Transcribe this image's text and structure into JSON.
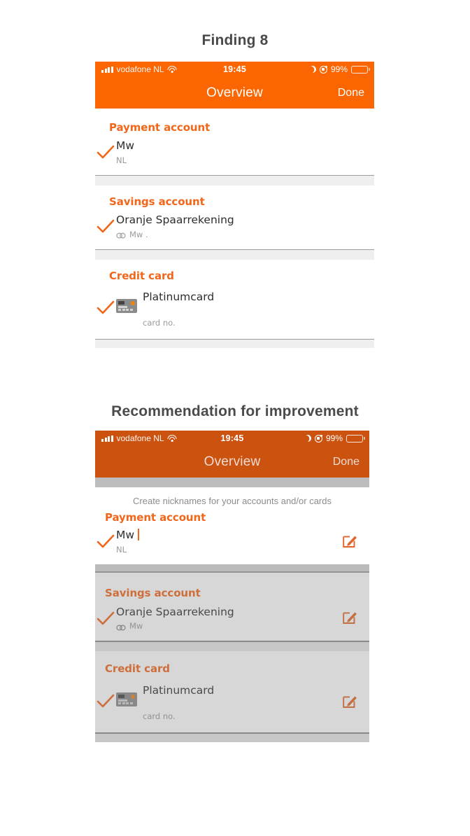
{
  "captions": {
    "finding": "Finding 8",
    "recommendation": "Recommendation for improvement"
  },
  "colors": {
    "accent_orange": "#f2661a",
    "header_orange": "#fb6502",
    "header_orange_dim": "#cc5210",
    "battery_yellow": "#f8cc0a",
    "divider_gray": "#9c9c9c",
    "band_gray": "#efefef",
    "subtext_gray": "#9a9a9a"
  },
  "status_bar": {
    "carrier": "vodafone NL",
    "time": "19:45",
    "battery_percent": "99%",
    "signal_icon": "signal-bars-icon",
    "wifi_icon": "wifi-icon",
    "moon_icon": "do-not-disturb-moon-icon",
    "lock_icon": "rotation-lock-icon",
    "battery_icon": "battery-icon"
  },
  "nav": {
    "title": "Overview",
    "done_label": "Done"
  },
  "screen_finding": {
    "sections": [
      {
        "group_title": "Payment account",
        "name": "Mw",
        "sub": "NL",
        "sub_icon": null,
        "leading_icon": null,
        "check_icon": "check-icon"
      },
      {
        "group_title": "Savings account",
        "name": "Oranje Spaarrekening",
        "sub": "Mw .",
        "sub_icon": "chain-link-icon",
        "leading_icon": null,
        "check_icon": "check-icon"
      },
      {
        "group_title": "Credit card",
        "name": "Platinumcard",
        "sub": "card no.",
        "sub_icon": null,
        "leading_icon": "credit-card-icon",
        "check_icon": "check-icon"
      }
    ]
  },
  "screen_recommendation": {
    "hint": "Create nicknames for your accounts and/or cards",
    "edit_icon": "edit-pencil-icon",
    "sections": [
      {
        "group_title": "Payment account",
        "name": "Mw",
        "sub": "NL",
        "sub_icon": null,
        "leading_icon": null,
        "check_icon": "check-icon",
        "has_caret": true,
        "highlighted": true
      },
      {
        "group_title": "Savings account",
        "name": "Oranje Spaarrekening",
        "sub": "Mw",
        "sub_icon": "chain-link-icon",
        "leading_icon": null,
        "check_icon": "check-icon",
        "has_caret": false,
        "highlighted": false
      },
      {
        "group_title": "Credit card",
        "name": "Platinumcard",
        "sub": "card no.",
        "sub_icon": null,
        "leading_icon": "credit-card-icon",
        "check_icon": "check-icon",
        "has_caret": false,
        "highlighted": false
      }
    ]
  }
}
